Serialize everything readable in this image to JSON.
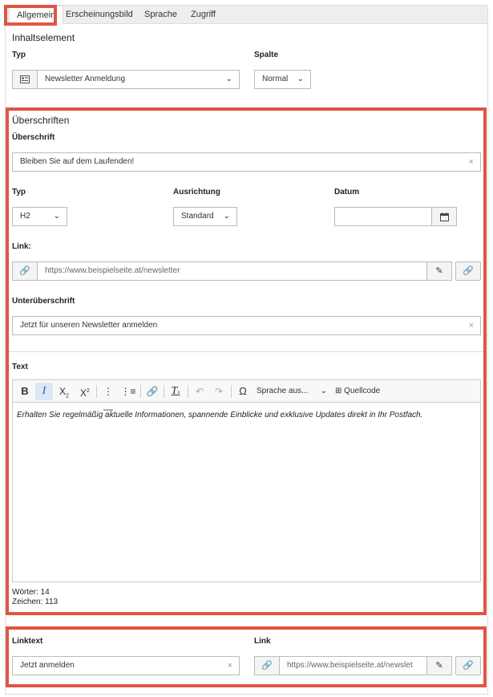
{
  "tabs": [
    "Allgemein",
    "Erscheinungsbild",
    "Sprache",
    "Zugriff"
  ],
  "content_element": {
    "title": "Inhaltselement",
    "type_label": "Typ",
    "type_value": "Newsletter Anmeldung",
    "column_label": "Spalte",
    "column_value": "Normal"
  },
  "headings": {
    "title": "Überschriften",
    "heading_label": "Überschrift",
    "heading_value": "Bleiben Sie auf dem Laufenden!",
    "type_label": "Typ",
    "type_value": "H2",
    "alignment_label": "Ausrichtung",
    "alignment_value": "Standard",
    "date_label": "Datum",
    "date_value": "",
    "link_label": "Link:",
    "link_value": "https://www.beispielseite.at/newsletter",
    "subheading_label": "Unterüberschrift",
    "subheading_value": "Jetzt für unseren Newsletter anmelden"
  },
  "text": {
    "label": "Text",
    "language_menu": "Sprache aus...",
    "source_label": "Quellcode",
    "content": "Erhalten Sie regelmäßig aktuelle Informationen, spannende Einblicke und exklusive Updates direkt in Ihr Postfach.",
    "words": "Wörter: 14",
    "chars": "Zeichen: 113"
  },
  "link_section": {
    "linktext_label": "Linktext",
    "linktext_value": "Jetzt anmelden",
    "link_label": "Link",
    "link_value": "https://www.beispielseite.at/newslet"
  },
  "icons": [
    "content-type-icon",
    "chevron-down-icon",
    "clear-icon",
    "calendar-icon",
    "link-icon",
    "link-browser-icon",
    "bold-icon",
    "italic-icon",
    "subscript-icon",
    "superscript-icon",
    "bullet-list-icon",
    "numbered-list-icon",
    "remove-format-icon",
    "undo-icon",
    "redo-icon",
    "special-char-icon",
    "source-code-icon"
  ],
  "accent_color": "#e05545"
}
